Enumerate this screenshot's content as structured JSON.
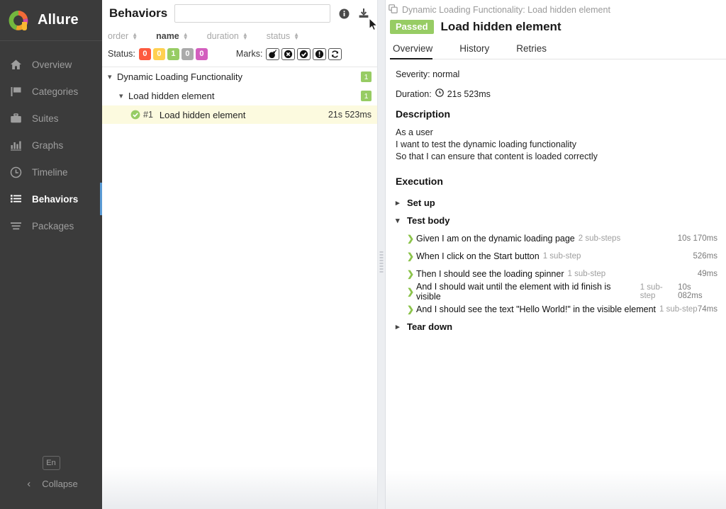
{
  "brand": {
    "name": "Allure",
    "logo_icon": "allure-ring-logo"
  },
  "sidebar": {
    "items": [
      {
        "label": "Overview",
        "icon": "home-icon",
        "active": false
      },
      {
        "label": "Categories",
        "icon": "flag-icon",
        "active": false
      },
      {
        "label": "Suites",
        "icon": "briefcase-icon",
        "active": false
      },
      {
        "label": "Graphs",
        "icon": "bar-chart-icon",
        "active": false
      },
      {
        "label": "Timeline",
        "icon": "clock-icon",
        "active": false
      },
      {
        "label": "Behaviors",
        "icon": "list-icon",
        "active": true
      },
      {
        "label": "Packages",
        "icon": "layers-icon",
        "active": false
      }
    ],
    "language_button": "En",
    "collapse_label": "Collapse",
    "collapse_icon": "chevron-left-icon",
    "accent_color": "#5b9bd5"
  },
  "middle": {
    "title": "Behaviors",
    "search_value": "",
    "search_placeholder": "",
    "info_icon": "info-circle-icon",
    "download_icon": "download-icon",
    "sort_columns": [
      {
        "label": "order",
        "active": false
      },
      {
        "label": "name",
        "active": true
      },
      {
        "label": "duration",
        "active": false
      },
      {
        "label": "status",
        "active": false
      }
    ],
    "status_label": "Status:",
    "status_chips": [
      {
        "value": "0",
        "color": "#fd5a3e",
        "name": "failed"
      },
      {
        "value": "0",
        "color": "#ffd050",
        "name": "broken"
      },
      {
        "value": "1",
        "color": "#97cc64",
        "name": "passed"
      },
      {
        "value": "0",
        "color": "#aaaaaa",
        "name": "skipped"
      },
      {
        "value": "0",
        "color": "#d35ebe",
        "name": "unknown"
      }
    ],
    "marks_label": "Marks:",
    "marks": [
      {
        "name": "flaky-bomb-icon"
      },
      {
        "name": "cancel-circle-icon"
      },
      {
        "name": "check-circle-icon"
      },
      {
        "name": "info-mark-icon"
      },
      {
        "name": "retry-icon"
      }
    ],
    "tree": [
      {
        "level": 1,
        "label": "Dynamic Loading Functionality",
        "chevron": "chevron-down-icon",
        "badge": "1",
        "selected": false
      },
      {
        "level": 2,
        "label": "Load hidden element",
        "chevron": "chevron-down-icon",
        "badge": "1",
        "selected": false
      },
      {
        "level": 3,
        "label": "Load hidden element",
        "number": "#1",
        "duration": "21s 523ms",
        "status_icon": "check-circle-icon",
        "selected": true
      }
    ]
  },
  "right": {
    "breadcrumb": "Dynamic Loading Functionality: Load hidden element",
    "breadcrumb_icon": "copy-icon",
    "status": "Passed",
    "status_color": "#97cc64",
    "title": "Load hidden element",
    "tabs": [
      {
        "label": "Overview",
        "active": true
      },
      {
        "label": "History",
        "active": false
      },
      {
        "label": "Retries",
        "active": false
      }
    ],
    "severity_line": "Severity: normal",
    "duration_label": "Duration:",
    "duration_icon": "clock-icon",
    "duration_value": "21s 523ms",
    "description_heading": "Description",
    "description_lines": [
      "As a user",
      "I want to test the dynamic loading functionality",
      "So that I can ensure that content is loaded correctly"
    ],
    "execution_heading": "Execution",
    "groups": [
      {
        "label": "Set up",
        "expanded": false,
        "chevron": "chevron-right-icon",
        "steps": []
      },
      {
        "label": "Test body",
        "expanded": true,
        "chevron": "chevron-down-icon",
        "steps": [
          {
            "text": "Given I am on the dynamic loading page",
            "substeps": "2 sub-steps",
            "duration": "10s 170ms"
          },
          {
            "text": "When I click on the Start button",
            "substeps": "1 sub-step",
            "duration": "526ms"
          },
          {
            "text": "Then I should see the loading spinner",
            "substeps": "1 sub-step",
            "duration": "49ms"
          },
          {
            "text": "And I should wait until the element with id finish is visible",
            "substeps": "1 sub-step",
            "duration": "10s 082ms"
          },
          {
            "text": "And I should see the text \"Hello World!\" in the visible element",
            "substeps": "1 sub-step",
            "duration": "74ms"
          }
        ]
      },
      {
        "label": "Tear down",
        "expanded": false,
        "chevron": "chevron-right-icon",
        "steps": []
      }
    ]
  }
}
